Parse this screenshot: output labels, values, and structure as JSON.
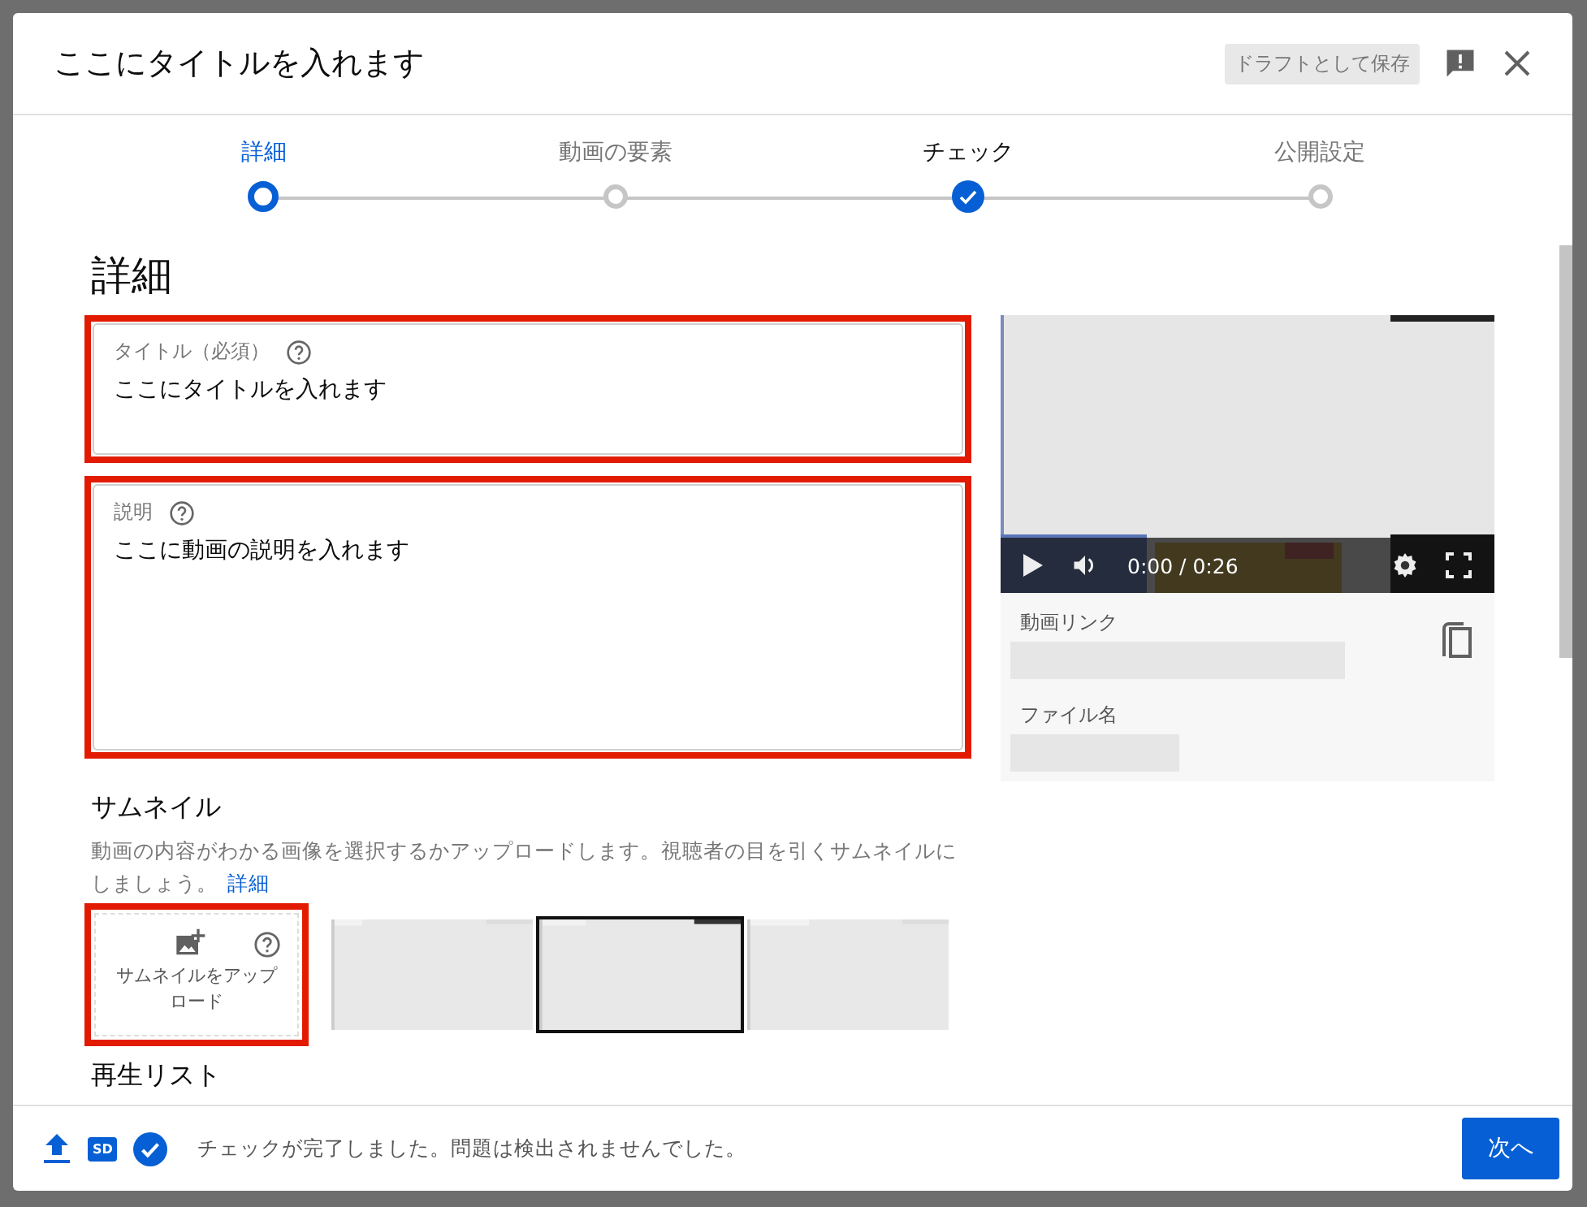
{
  "dialog": {
    "title": "ここにタイトルを入れます",
    "draft_button": "ドラフトとして保存"
  },
  "steps": [
    {
      "label": "詳細",
      "selected": true,
      "done": false
    },
    {
      "label": "動画の要素",
      "selected": false,
      "done": false
    },
    {
      "label": "チェック",
      "selected": false,
      "done": true
    },
    {
      "label": "公開設定",
      "selected": false,
      "done": false
    }
  ],
  "section_title": "詳細",
  "title_field": {
    "label": "タイトル（必須）",
    "value": "ここにタイトルを入れます",
    "highlighted": true
  },
  "description_field": {
    "label": "説明",
    "value": "ここに動画の説明を入れます",
    "highlighted": true
  },
  "thumbnail": {
    "heading": "サムネイル",
    "text": "動画の内容がわかる画像を選択するかアップロードします。視聴者の目を引くサムネイルにしましょう。",
    "link": "詳細",
    "upload_label": "サムネイルをアップロード",
    "highlighted": true,
    "options": [
      {
        "selected": false
      },
      {
        "selected": true
      },
      {
        "selected": false
      }
    ]
  },
  "playlist_heading": "再生リスト",
  "video": {
    "time": "0:00 / 0:26",
    "link_label": "動画リンク",
    "filename_label": "ファイル名"
  },
  "footer": {
    "sd_badge": "SD",
    "status": "チェックが完了しました。問題は検出されませんでした。",
    "next_button": "次へ"
  }
}
